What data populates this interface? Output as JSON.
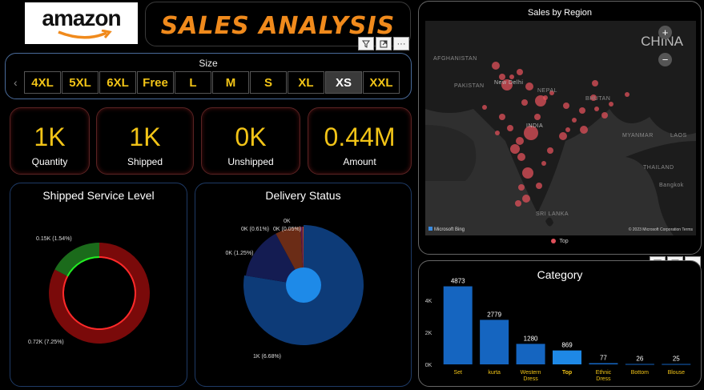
{
  "logo": {
    "text": "amazon"
  },
  "title": "SALES ANALYSIS",
  "size_slicer": {
    "label": "Size",
    "options": [
      "4XL",
      "5XL",
      "6XL",
      "Free",
      "L",
      "M",
      "S",
      "XL",
      "XS",
      "XXL"
    ],
    "selected": "XS"
  },
  "kpis": [
    {
      "value": "1K",
      "label": "Quantity"
    },
    {
      "value": "1K",
      "label": "Shipped"
    },
    {
      "value": "0K",
      "label": "Unshipped"
    },
    {
      "value": "0.44M",
      "label": "Amount"
    }
  ],
  "icons": {
    "filter": "filter-icon",
    "focus": "focus-mode-icon",
    "more": "more-options-icon"
  },
  "colors": {
    "accent": "#f2c417",
    "title": "#f08a1c",
    "bar": "#1565c0",
    "top_bar": "#1e88e5",
    "map_dot": "#e0505a"
  },
  "map": {
    "title": "Sales by Region",
    "country_label": "CHINA",
    "zoom_in": "+",
    "zoom_out": "−",
    "places": [
      "AFGHANISTAN",
      "PAKISTAN",
      "New Delhi",
      "NEPAL",
      "INDIA",
      "BHUTAN",
      "MYANMAR",
      "THAILAND",
      "SRI LANKA",
      "LAOS",
      "Bangkok"
    ],
    "legend": "Top",
    "provider": "Microsoft Bing",
    "copyright": "© 2023 Microsoft Corporation  Terms"
  },
  "chart_data": [
    {
      "type": "pie",
      "title": "Shipped Service Level",
      "donut": true,
      "slices": [
        {
          "label": "0.72K (7.25%)",
          "value": 0.72,
          "color": "#7a0a0a"
        },
        {
          "label": "0.15K (1.54%)",
          "value": 0.15,
          "color": "#1b6b1b"
        }
      ]
    },
    {
      "type": "pie",
      "title": "Delivery Status",
      "slices": [
        {
          "label": "1K (6.68%)",
          "value": 6.68,
          "color": "#0d3b78"
        },
        {
          "label": "0K (1.25%)",
          "value": 1.25,
          "color": "#141c52"
        },
        {
          "label": "0K (0.61%)",
          "value": 0.61,
          "color": "#6b2c16"
        },
        {
          "label": "0K (0.05%)",
          "value": 0.05,
          "color": "#5a1a4a"
        },
        {
          "label": "0K",
          "value": 0.02,
          "color": "#c04a20"
        }
      ]
    },
    {
      "type": "bar",
      "title": "Category",
      "categories": [
        "Set",
        "kurta",
        "Western Dress",
        "Top",
        "Ethnic Dress",
        "Bottom",
        "Blouse"
      ],
      "values": [
        4873,
        2779,
        1280,
        869,
        77,
        26,
        25
      ],
      "value_labels": [
        "4873",
        "2779",
        "1280",
        "869",
        "77",
        "26",
        "25"
      ],
      "highlighted": "Top",
      "ylim": [
        0,
        5000
      ],
      "yticks": [
        "0K",
        "2K",
        "4K"
      ]
    }
  ]
}
